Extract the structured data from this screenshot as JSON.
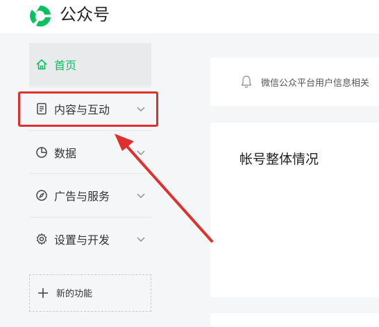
{
  "header": {
    "logo_icon": "wechat-official-account-logo-icon",
    "app_title": "公众号"
  },
  "sidebar": {
    "items": [
      {
        "label": "首页",
        "icon": "home-icon",
        "active": true,
        "expandable": false
      },
      {
        "label": "内容与互动",
        "icon": "document-icon",
        "active": false,
        "expandable": true,
        "highlighted": true
      },
      {
        "label": "数据",
        "icon": "pie-chart-icon",
        "active": false,
        "expandable": true
      },
      {
        "label": "广告与服务",
        "icon": "compass-icon",
        "active": false,
        "expandable": true
      },
      {
        "label": "设置与开发",
        "icon": "gear-icon",
        "active": false,
        "expandable": true
      }
    ],
    "new_feature": {
      "label": "新的功能",
      "icon": "plus-icon"
    }
  },
  "main": {
    "notice": {
      "icon": "bell-icon",
      "text": "微信公众平台用户信息相关"
    },
    "overview": {
      "title": "帐号整体情况"
    }
  },
  "colors": {
    "accent": "#07c160",
    "annotation": "#e0302d",
    "page_background": "#f5f6f7",
    "card_background": "#ffffff"
  }
}
